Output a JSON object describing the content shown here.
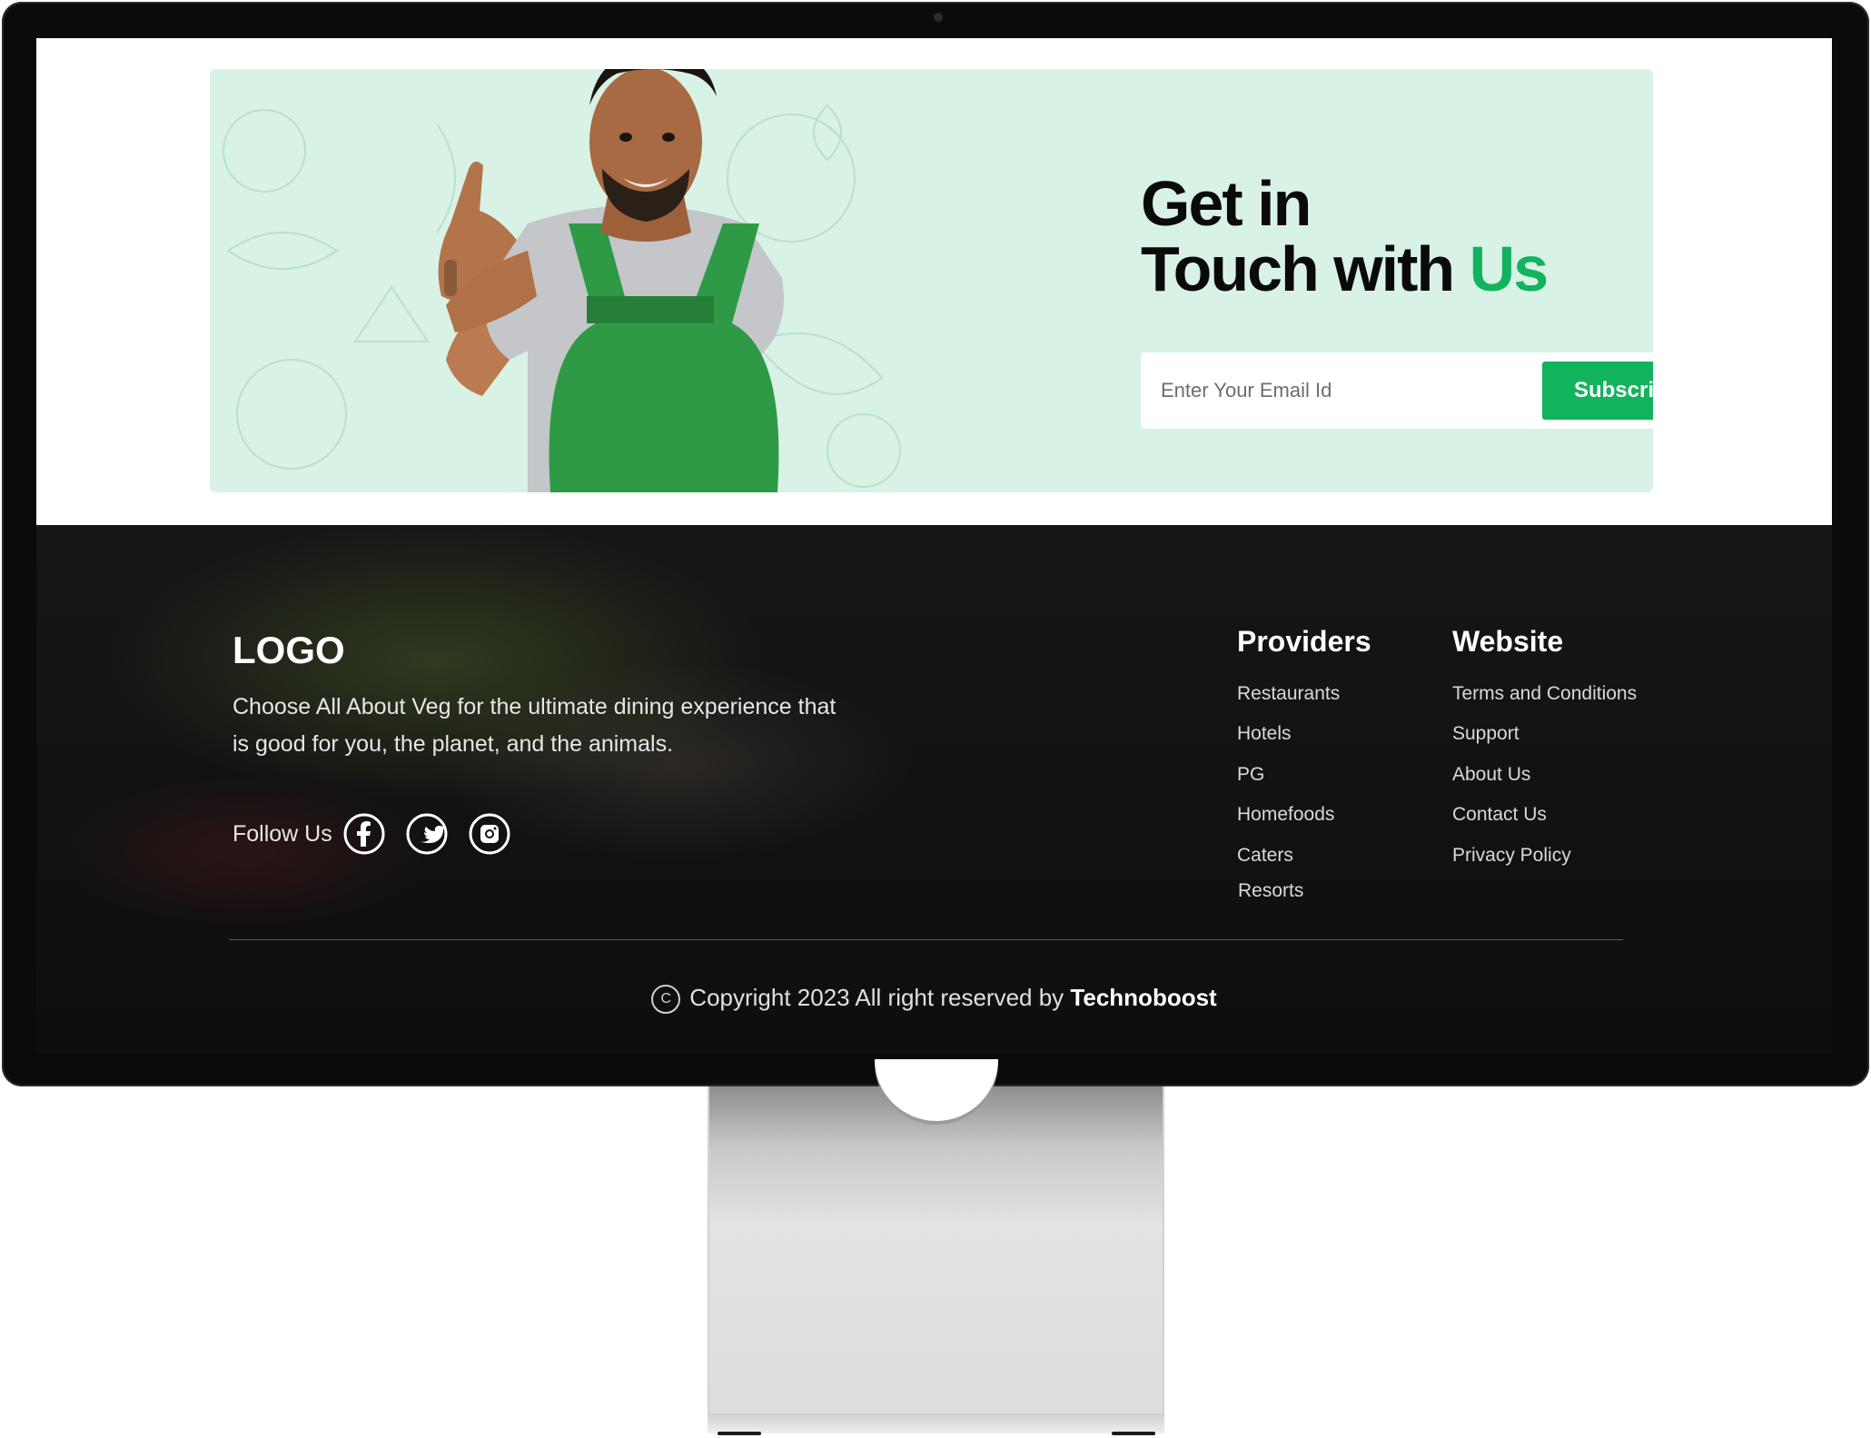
{
  "banner": {
    "headline_line1": "Get in",
    "headline_line2_prefix": "Touch with ",
    "headline_line2_accent": "Us",
    "email_placeholder": "Enter Your Email Id",
    "subscribe_label": "Subscribe"
  },
  "footer": {
    "logo": "LOGO",
    "tagline": "Choose All About Veg for the ultimate dining experience that is good for you, the planet, and the animals.",
    "follow_label": "Follow Us",
    "social_icons": [
      "facebook-icon",
      "twitter-icon",
      "instagram-icon"
    ],
    "providers": {
      "title": "Providers",
      "links": [
        "Restaurants",
        "Hotels",
        "PG",
        "Homefoods",
        "Caters",
        "Resorts"
      ]
    },
    "website": {
      "title": "Website",
      "links": [
        "Terms and Conditions",
        "Support",
        "About Us",
        "Contact Us",
        "Privacy Policy"
      ]
    },
    "copyright_symbol": "C",
    "copyright_text": "Copyright 2023 All right reserved by ",
    "copyright_brand": "Technoboost"
  },
  "colors": {
    "accent": "#12b35e",
    "banner_bg": "#d8f2e5",
    "footer_bg": "#0e0e0e"
  }
}
